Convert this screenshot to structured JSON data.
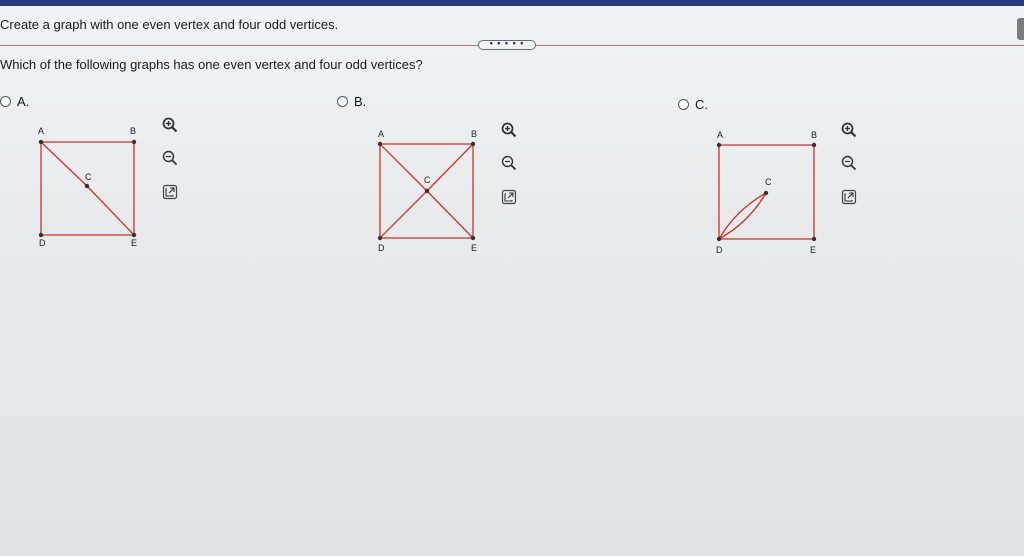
{
  "instruction": "Create a graph with one even vertex and four odd vertices.",
  "question": "Which of the following graphs has one even vertex and four odd vertices?",
  "collapse_handle": "• • • • •",
  "colors": {
    "edge": "#d0302a",
    "vertex": "#333333",
    "topbar": "#283a80"
  },
  "options": [
    {
      "letter": "A.",
      "vertex_labels": {
        "A": "A",
        "B": "B",
        "C": "C",
        "D": "D",
        "E": "E"
      },
      "edges": [
        [
          "A",
          "B"
        ],
        [
          "B",
          "E"
        ],
        [
          "E",
          "D"
        ],
        [
          "D",
          "A"
        ],
        [
          "A",
          "C"
        ],
        [
          "C",
          "E"
        ]
      ],
      "tools": [
        "zoom-in-icon",
        "zoom-out-icon",
        "pop-out-icon"
      ]
    },
    {
      "letter": "B.",
      "vertex_labels": {
        "A": "A",
        "B": "B",
        "C": "C",
        "D": "D",
        "E": "E"
      },
      "edges": [
        [
          "A",
          "B"
        ],
        [
          "B",
          "E"
        ],
        [
          "E",
          "D"
        ],
        [
          "D",
          "A"
        ],
        [
          "A",
          "C"
        ],
        [
          "C",
          "E"
        ],
        [
          "B",
          "C"
        ],
        [
          "C",
          "D"
        ]
      ],
      "tools": [
        "zoom-in-icon",
        "zoom-out-icon",
        "pop-out-icon"
      ]
    },
    {
      "letter": "C.",
      "vertex_labels": {
        "A": "A",
        "B": "B",
        "C": "C",
        "D": "D",
        "E": "E"
      },
      "edges": [
        [
          "A",
          "B"
        ],
        [
          "B",
          "E"
        ],
        [
          "E",
          "D"
        ],
        [
          "A",
          "D"
        ],
        [
          "D",
          "C",
          "upper"
        ],
        [
          "D",
          "C",
          "lower"
        ]
      ],
      "tools": [
        "zoom-in-icon",
        "zoom-out-icon",
        "pop-out-icon"
      ]
    }
  ]
}
